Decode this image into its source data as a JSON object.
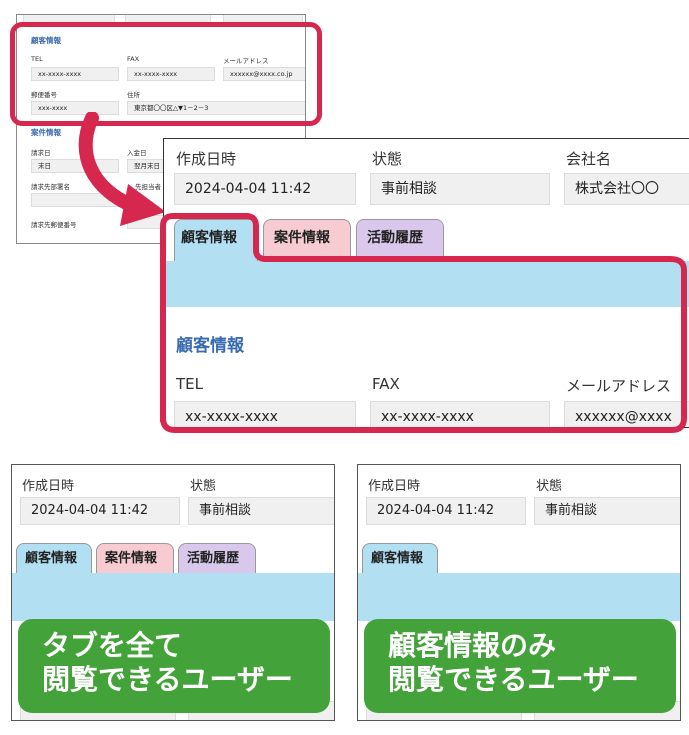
{
  "colors": {
    "accent_red": "#d6274f",
    "customer_tab": "#b3dff3",
    "case_tab": "#f6cbd1",
    "history_tab": "#d9c8ec",
    "caption_green": "#43a33a",
    "section_blue": "#3a6ab0"
  },
  "background_screen": {
    "section_customer": "顧客情報",
    "tel_label": "TEL",
    "tel_value": "xx-xxxx-xxxx",
    "fax_label": "FAX",
    "fax_value": "xx-xxxx-xxxx",
    "mail_label": "メールアドレス",
    "mail_value": "xxxxxx@xxxx.co.jp",
    "zip_label": "郵便番号",
    "zip_value": "xxx-xxxx",
    "address_label": "住所",
    "address_value": "東京都〇〇区△▼1－2－3",
    "section_case": "案件情報",
    "billing_label": "請求日",
    "billing_value": "末日",
    "deposit_label": "入金日",
    "deposit_value": "翌月末日",
    "billing_dept_label": "請求先部署名",
    "contact_label": "先担当者",
    "billing_zip_label": "請求先郵便番号"
  },
  "zoom_screen": {
    "created_label": "作成日時",
    "created_value": "2024-04-04 11:42",
    "status_label": "状態",
    "status_value": "事前相談",
    "company_label": "会社名",
    "company_value": "株式会社〇〇",
    "tabs": [
      "顧客情報",
      "案件情報",
      "活動履歴"
    ],
    "section_title": "顧客情報",
    "tel_label": "TEL",
    "tel_value": "xx-xxxx-xxxx",
    "fax_label": "FAX",
    "fax_value": "xx-xxxx-xxxx",
    "mail_label": "メールアドレス",
    "mail_value": "xxxxxx@xxxx"
  },
  "left_panel": {
    "created_label": "作成日時",
    "created_value": "2024-04-04 11:42",
    "status_label": "状態",
    "status_value": "事前相談",
    "tabs": [
      "顧客情報",
      "案件情報",
      "活動履歴"
    ],
    "caption_line1": "タブを全て",
    "caption_line2": "閲覧できるユーザー"
  },
  "right_panel": {
    "created_label": "作成日時",
    "created_value": "2024-04-04 11:42",
    "status_label": "状態",
    "status_value": "事前相談",
    "tabs": [
      "顧客情報"
    ],
    "caption_line1": "顧客情報のみ",
    "caption_line2": "閲覧できるユーザー"
  }
}
